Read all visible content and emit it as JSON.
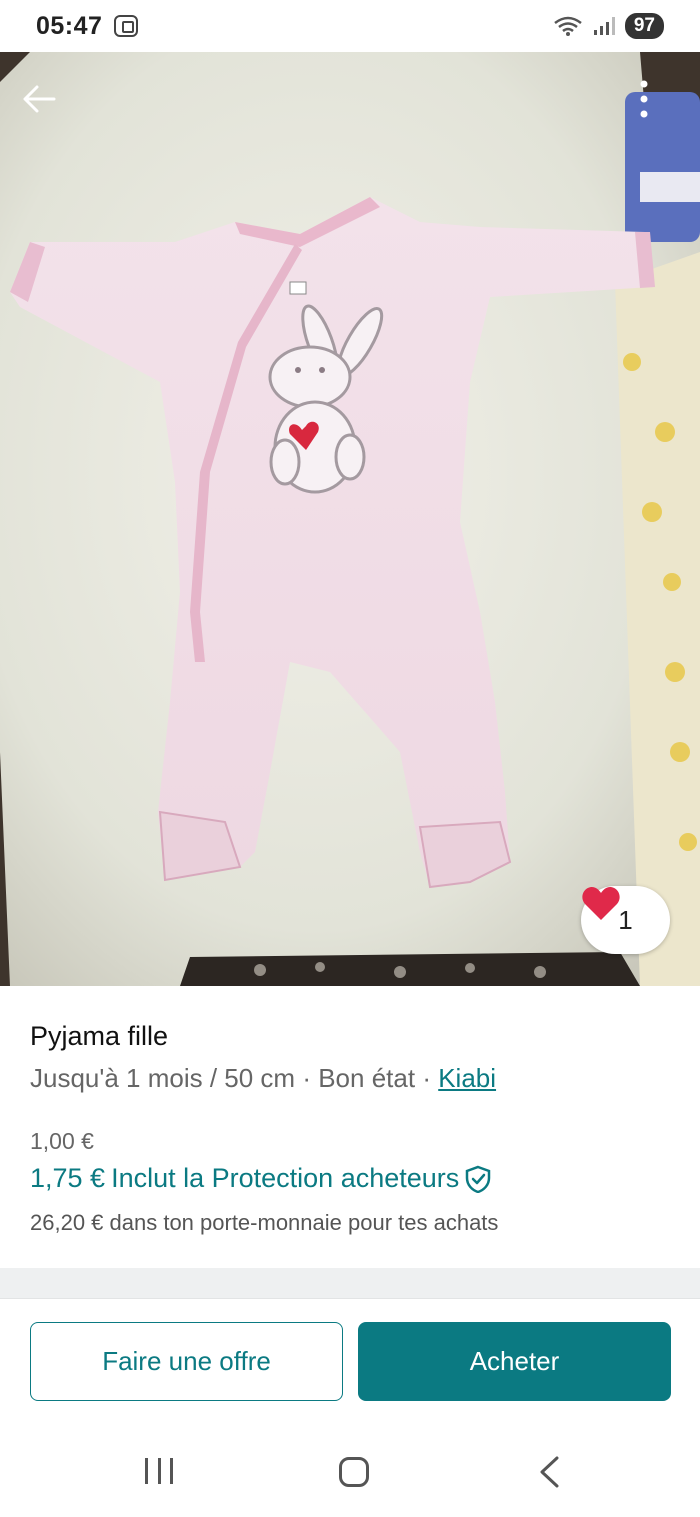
{
  "status_bar": {
    "time": "05:47",
    "battery": "97",
    "icons": [
      "screenshot-icon",
      "wifi-icon",
      "signal-icon"
    ]
  },
  "photo": {
    "description_icons": [
      "back-arrow-icon",
      "more-vertical-icon",
      "heart-icon"
    ],
    "likes": "1",
    "heart_color": "#e0294a"
  },
  "item": {
    "title": "Pyjama fille",
    "size": "Jusqu'à 1 mois / 50 cm",
    "separator1": "·",
    "condition": "Bon état",
    "separator2": "·",
    "brand": "Kiabi"
  },
  "price": {
    "base": "1,00 €",
    "total": "1,75 €",
    "protection_label": "Inclut la Protection acheteurs",
    "wallet": "26,20 € dans ton porte-monnaie pour tes achats"
  },
  "actions": {
    "offer_label": "Faire une offre",
    "buy_label": "Acheter"
  },
  "colors": {
    "accent": "#0b7a82",
    "text_secondary": "#666666"
  }
}
